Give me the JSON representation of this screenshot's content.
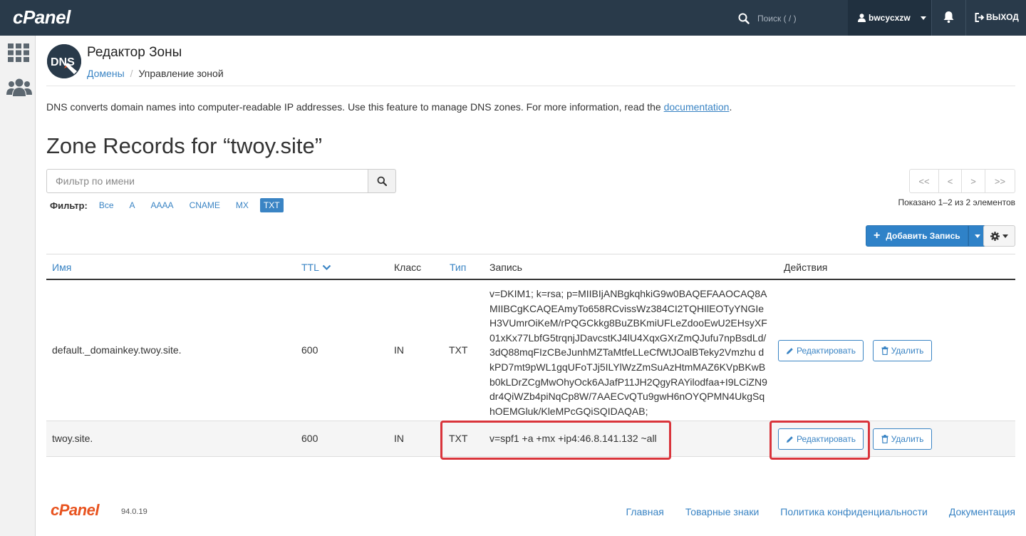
{
  "topbar": {
    "logo": "cPanel",
    "search_placeholder": "Поиск ( / )",
    "username": "bwcycxzw",
    "logout": "ВЫХОД"
  },
  "header": {
    "title": "Редактор Зоны",
    "breadcrumb_link": "Домены",
    "breadcrumb_current": "Управление зоной",
    "logo_text": "DNS"
  },
  "description": {
    "text": "DNS converts domain names into computer-readable IP addresses. Use this feature to manage DNS zones. For more information, read the ",
    "link": "documentation",
    "end": "."
  },
  "zone_title": "Zone Records for “twoy.site”",
  "filter": {
    "placeholder": "Фильтр по имени",
    "label": "Фильтр:",
    "types": [
      "Все",
      "A",
      "AAAA",
      "CNAME",
      "MX",
      "TXT"
    ],
    "active_type": "TXT"
  },
  "pagination": {
    "first": "<<",
    "prev": "<",
    "next": ">",
    "last": ">>",
    "shown": "Показано 1–2 из 2 элементов"
  },
  "add_record_label": "Добавить Запись",
  "table": {
    "headers": {
      "name": "Имя",
      "ttl": "TTL",
      "class": "Класс",
      "type": "Тип",
      "record": "Запись",
      "actions": "Действия"
    },
    "rows": [
      {
        "name": "default._domainkey.twoy.site.",
        "ttl": "600",
        "class": "IN",
        "type": "TXT",
        "record": "v=DKIM1; k=rsa; p=MIIBIjANBgkqhkiG9w0BAQEFAAOCAQ8AMIIBCgKCAQEAmyTo658RCvissWz384CI2TQHIlEOTyYNGIeH3VUmrOiKeM/rPQGCkkg8BuZBKmiUFLeZdooEwU2EHsyXF01xKx77LbfG5trqnjJDavcstKJ4lU4XqxGXrZmQJufu7npBsdLd/3dQ88mqFIzCBeJunhMZTaMtfeLLeCfWtJOalBTeky2Vmzhu dkPD7mt9pWL1gqUFoTJj5ILYlWzZmSuAzHtmMAZ6KVpBKwBb0kLDrZCgMwOhyOck6AJafP11JH2QgyRAYilodfaa+I9LCiZN9dr4QiWZb4piNqCp8W/7AAECvQTu9gwH6nOYQPMN4UkgSqhOEMGluk/KleMPcGQiSQIDAQAB;",
        "edit": "Редактировать",
        "delete": "Удалить"
      },
      {
        "name": "twoy.site.",
        "ttl": "600",
        "class": "IN",
        "type": "TXT",
        "record": "v=spf1 +a +mx +ip4:46.8.141.132 ~all",
        "edit": "Редактировать",
        "delete": "Удалить"
      }
    ]
  },
  "footer": {
    "logo": "cPanel",
    "version": "94.0.19",
    "links": [
      "Главная",
      "Товарные знаки",
      "Политика конфиденциальности",
      "Документация"
    ]
  },
  "colors": {
    "topbar": "#293a4a",
    "link": "#3a84c4",
    "primary": "#2f82c8",
    "highlight": "#d9343b",
    "footer_logo": "#e8531f"
  }
}
